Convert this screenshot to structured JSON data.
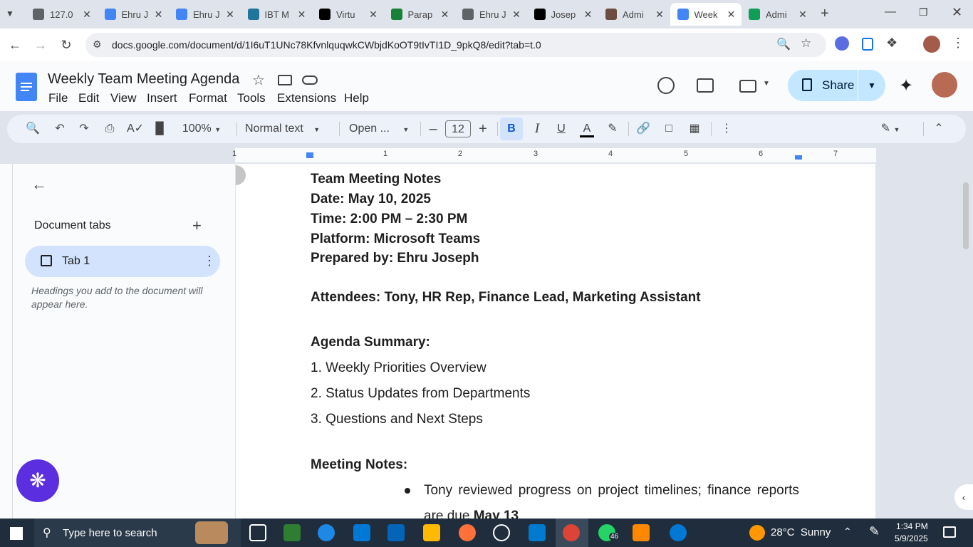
{
  "browser": {
    "tabs": [
      {
        "title": "127.0",
        "color": "#5f6368"
      },
      {
        "title": "Ehru J",
        "color": "#4285f4"
      },
      {
        "title": "Ehru J",
        "color": "#4285f4"
      },
      {
        "title": "IBT M",
        "color": "#21759b"
      },
      {
        "title": "Virtu",
        "color": "#000000"
      },
      {
        "title": "Parap",
        "color": "#188038"
      },
      {
        "title": "Ehru J",
        "color": "#5f6368"
      },
      {
        "title": "Josep",
        "color": "#000000"
      },
      {
        "title": "Admi",
        "color": "#6d4c41"
      },
      {
        "title": "Week",
        "color": "#4285f4",
        "active": true
      },
      {
        "title": "Admi",
        "color": "#0f9d58"
      }
    ],
    "url": "docs.google.com/document/d/1I6uT1UNc78KfvnlquqwkCWbjdKoOT9tIvTI1D_9pkQ8/edit?tab=t.0"
  },
  "docs": {
    "title": "Weekly Team Meeting Agenda",
    "menu": [
      "File",
      "Edit",
      "View",
      "Insert",
      "Format",
      "Tools",
      "Extensions",
      "Help"
    ],
    "share_label": "Share",
    "toolbar": {
      "zoom": "100%",
      "style": "Normal text",
      "font": "Open ...",
      "font_size": "12"
    },
    "ruler_ticks": [
      "1",
      "1",
      "2",
      "3",
      "4",
      "5",
      "6",
      "7"
    ],
    "sidebar": {
      "heading": "Document tabs",
      "tab_label": "Tab 1",
      "hint": "Headings you add to the document will appear here."
    },
    "document": {
      "lines": [
        "Team Meeting Notes",
        "Date: May 10, 2025",
        "Time: 2:00 PM – 2:30 PM",
        "Platform: Microsoft Teams",
        "Prepared by: Ehru Joseph",
        "Attendees: Tony, HR Rep, Finance Lead, Marketing Assistant",
        "Agenda Summary:",
        "1. Weekly Priorities Overview",
        "2. Status Updates from Departments",
        "3. Questions and Next Steps",
        "Meeting Notes:"
      ],
      "bullet1_text": "Tony reviewed progress on project timelines; finance reports",
      "bullet1_cont": "are due",
      "bullet1_bold": "May 13"
    }
  },
  "taskbar": {
    "search_placeholder": "Type here to search",
    "weather": "28°C  Sunny",
    "time": "1:34 PM",
    "date": "5/9/2025",
    "whatsapp_badge": "46"
  },
  "icons": [
    "search-icon",
    "undo-icon",
    "redo-icon",
    "print-icon",
    "spellcheck-icon",
    "paint-format-icon",
    "bold-icon",
    "italic-icon",
    "underline-icon",
    "text-color-icon",
    "highlight-icon",
    "link-icon",
    "comment-icon",
    "image-icon",
    "more-icon",
    "pencil-icon",
    "collapse-icon",
    "history-icon",
    "comments-icon",
    "meet-icon",
    "lock-icon",
    "gemini-icon",
    "star-icon",
    "folder-icon",
    "cloud-icon"
  ]
}
